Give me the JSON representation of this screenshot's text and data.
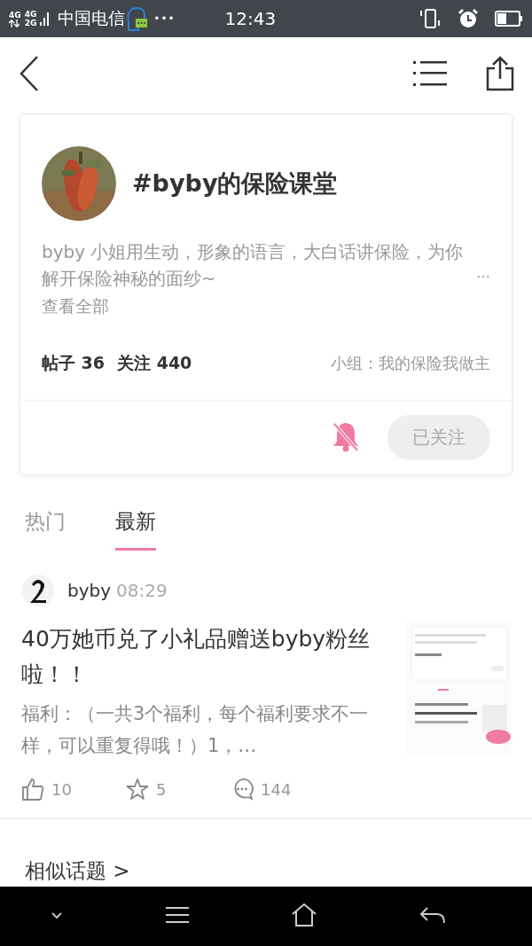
{
  "status_bar": {
    "network_1": "4G",
    "network_2": "4G",
    "network_3": "2G",
    "carrier": "中国电信",
    "more": "•••",
    "time": "12:43"
  },
  "topic": {
    "title": "#byby的保险课堂",
    "description": "byby 小姐用生动，形象的语言，大白话讲保险，为你解开保险神秘的面纱~",
    "more": "…",
    "view_all": "查看全部",
    "posts_label": "帖子",
    "posts": "36",
    "follows_label": "关注",
    "follows": "440",
    "group": "小组：我的保险我做主",
    "notify_muted": true,
    "follow_button": "已关注",
    "followed": true
  },
  "tabs": [
    {
      "label": "热门",
      "selected": false
    },
    {
      "label": "最新",
      "selected": true
    }
  ],
  "posts": [
    {
      "author": "byby",
      "time": "08:29",
      "title": "40万她币兑了小礼品赠送byby粉丝啦！！",
      "excerpt": "福利：（一共3个福利，每个福利要求不一样，可以重复得哦！）1，…",
      "likes": "10",
      "favorites": "5",
      "comments": "144"
    }
  ],
  "related": {
    "label": "相似话题",
    "arrow": ">"
  }
}
